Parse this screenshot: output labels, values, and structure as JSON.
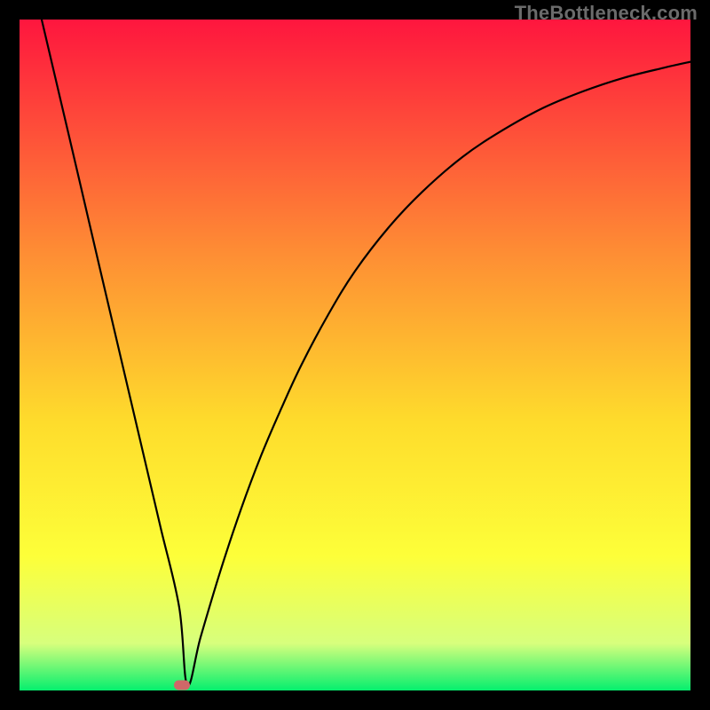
{
  "attribution": "TheBottleneck.com",
  "colors": {
    "frame": "#000000",
    "gradient_top": "#fe163e",
    "gradient_mid1": "#fe8e34",
    "gradient_mid2": "#fedc2c",
    "gradient_mid3": "#fdff39",
    "gradient_mid4": "#d7ff7d",
    "gradient_bottom": "#05ef6e",
    "curve": "#000000",
    "marker": "#cf6868"
  },
  "chart_data": {
    "type": "line",
    "title": "",
    "xlabel": "",
    "ylabel": "",
    "xlim": [
      0,
      100
    ],
    "ylim": [
      0,
      100
    ],
    "series": [
      {
        "name": "bottleneck-curve",
        "x": [
          3.3,
          6,
          9,
          12,
          15,
          18,
          21,
          23.8,
          25,
          27,
          30,
          33,
          36,
          39,
          42,
          46,
          50,
          55,
          60,
          66,
          72,
          78,
          84,
          90,
          96,
          100
        ],
        "y": [
          100,
          88.5,
          75.7,
          62.8,
          50,
          37.2,
          24.4,
          12.4,
          0.8,
          8,
          18,
          27,
          35,
          42,
          48.5,
          56,
          62.5,
          69,
          74.3,
          79.5,
          83.5,
          86.8,
          89.3,
          91.3,
          92.8,
          93.7
        ]
      }
    ],
    "marker": {
      "x": 24.2,
      "y": 0.8
    },
    "gradient_stops": [
      {
        "pos": 0.0,
        "color": "#fe163e"
      },
      {
        "pos": 0.35,
        "color": "#fe8e34"
      },
      {
        "pos": 0.6,
        "color": "#fedc2c"
      },
      {
        "pos": 0.8,
        "color": "#fdff39"
      },
      {
        "pos": 0.93,
        "color": "#d7ff7d"
      },
      {
        "pos": 1.0,
        "color": "#05ef6e"
      }
    ]
  }
}
